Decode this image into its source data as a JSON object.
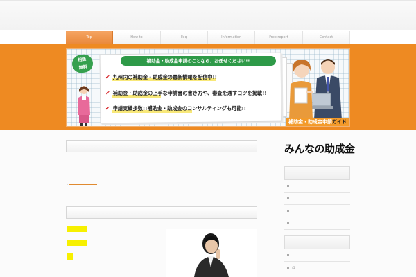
{
  "nav": {
    "items": [
      {
        "label": "Top",
        "active": true
      },
      {
        "label": "How to",
        "active": false
      },
      {
        "label": "Faq",
        "active": false
      },
      {
        "label": "Information",
        "active": false
      },
      {
        "label": "Free report",
        "active": false
      },
      {
        "label": "Contact",
        "active": false
      }
    ]
  },
  "banner": {
    "stamp": "相談\n無料",
    "title": "補助金・助成金申請のことなら、お任せください!!",
    "lines": [
      "九州内の補助金・助成金の最新情報を配信中!!",
      "補助金・助成金の上手な申請書の書き方や、審査を通すコツを掲載!!",
      "申請実績多数!!補助金・助成金のコンサルティングも可能!!"
    ],
    "guide_orange": "補助金・助成金申請",
    "guide_black": "ガイド"
  },
  "sidebar": {
    "logo": "みんなの助成金",
    "section2_item_text": "@ー"
  },
  "colors": {
    "accent": "#ee8a22",
    "banner_title_bg": "#2e9a48",
    "highlight_yellow": "#f7f000"
  }
}
